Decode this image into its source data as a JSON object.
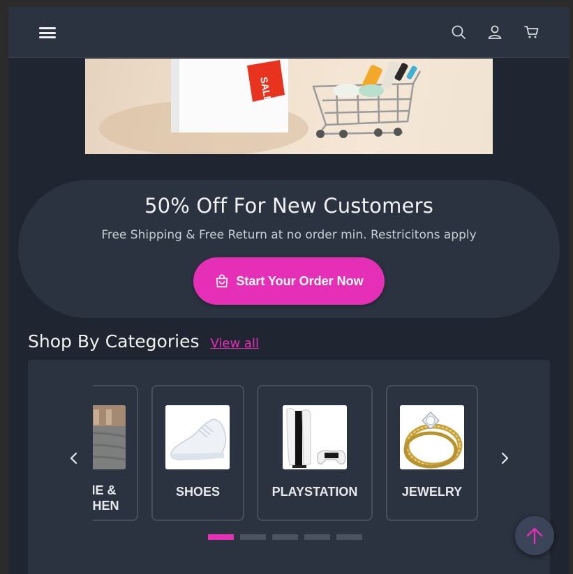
{
  "header": {
    "icons": [
      "hamburger-icon",
      "search-icon",
      "user-icon",
      "cart-icon"
    ]
  },
  "banner": {
    "sale_tag": "SALE"
  },
  "promo": {
    "title": "50% Off For New Customers",
    "subtitle": "Free Shipping & Free Return at no order min. Restricitons apply",
    "button_label": "Start Your Order Now",
    "button_icon": "shopping-bag-icon"
  },
  "categories": {
    "title": "Shop By Categories",
    "view_all": "View all",
    "items": [
      {
        "label": "HOME & KITCHEN"
      },
      {
        "label": "SHOES"
      },
      {
        "label": "PLAYSTATION"
      },
      {
        "label": "JEWELRY"
      }
    ],
    "page_count": 5,
    "active_page": 1
  },
  "colors": {
    "accent": "#e42fb6",
    "background": "#1f2631",
    "surface": "#2b3340"
  }
}
